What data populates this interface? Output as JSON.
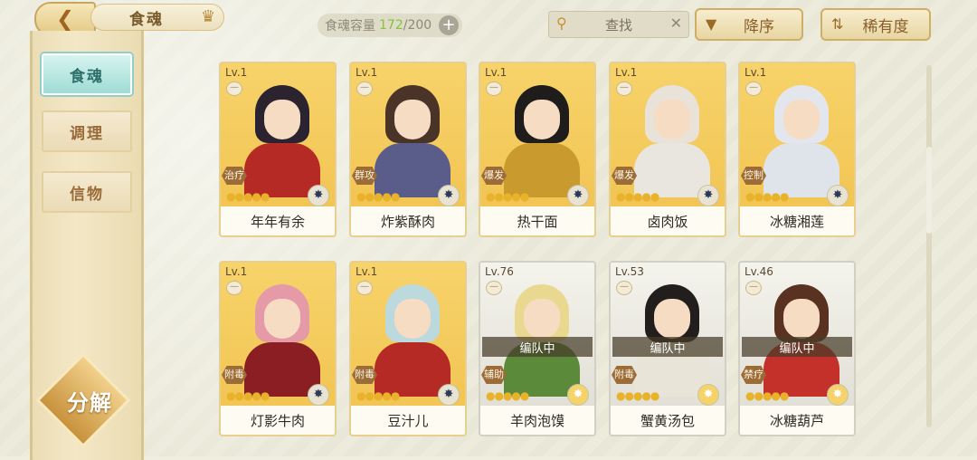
{
  "header": {
    "back_icon": "back-arrow-icon",
    "title": "食魂",
    "capacity_label": "食魂容量",
    "capacity_current": "172",
    "capacity_max": "/200",
    "capacity_add": "+",
    "search_placeholder": "查找",
    "search_clear": "✕",
    "sort_order_label": "降序",
    "sort_by_label": "稀有度"
  },
  "sidebar": {
    "items": [
      {
        "label": "食魂",
        "active": true
      },
      {
        "label": "调理",
        "active": false
      },
      {
        "label": "信物",
        "active": false
      }
    ],
    "decompose_label": "分解"
  },
  "cards": [
    {
      "level": "Lv.1",
      "role": "治疗",
      "name": "年年有余",
      "stars": "●●●●●",
      "owned": false,
      "hair": "#2b2430",
      "outfit": "#b52a24",
      "elem_gold": false
    },
    {
      "level": "Lv.1",
      "role": "群攻",
      "name": "炸紫酥肉",
      "stars": "●●●●●",
      "owned": false,
      "hair": "#4a3428",
      "outfit": "#5a5c8a",
      "elem_gold": false
    },
    {
      "level": "Lv.1",
      "role": "爆发",
      "name": "热干面",
      "stars": "●●●●●",
      "owned": false,
      "hair": "#1f1c1c",
      "outfit": "#c99a2e",
      "elem_gold": false
    },
    {
      "level": "Lv.1",
      "role": "爆发",
      "name": "卤肉饭",
      "stars": "●●●●●",
      "owned": false,
      "hair": "#e8e2d8",
      "outfit": "#e9e6e0",
      "elem_gold": false
    },
    {
      "level": "Lv.1",
      "role": "控制",
      "name": "冰糖湘莲",
      "stars": "●●●●●",
      "owned": false,
      "hair": "#e4e6ee",
      "outfit": "#dfe3ea",
      "elem_gold": false
    },
    {
      "level": "Lv.1",
      "role": "附毒",
      "name": "灯影牛肉",
      "stars": "●●●●●",
      "owned": false,
      "hair": "#e59aa8",
      "outfit": "#8a1e22",
      "elem_gold": false
    },
    {
      "level": "Lv.1",
      "role": "附毒",
      "name": "豆汁儿",
      "stars": "●●●●●",
      "owned": false,
      "hair": "#bcd9de",
      "outfit": "#b52a24",
      "elem_gold": false
    },
    {
      "level": "Lv.76",
      "role": "辅助",
      "name": "羊肉泡馍",
      "stars": "●●●●●",
      "owned": true,
      "team": "编队中",
      "hair": "#e9d890",
      "outfit": "#5a8a3a",
      "elem_gold": true
    },
    {
      "level": "Lv.53",
      "role": "附毒",
      "name": "蟹黄汤包",
      "stars": "●●●●●",
      "owned": true,
      "team": "编队中",
      "hair": "#231e1e",
      "outfit": "#e9e4d8",
      "elem_gold": true
    },
    {
      "level": "Lv.46",
      "role": "禁疗",
      "name": "冰糖葫芦",
      "stars": "●●●●●",
      "owned": true,
      "team": "编队中",
      "hair": "#5a3222",
      "outfit": "#c4302a",
      "elem_gold": true
    }
  ]
}
